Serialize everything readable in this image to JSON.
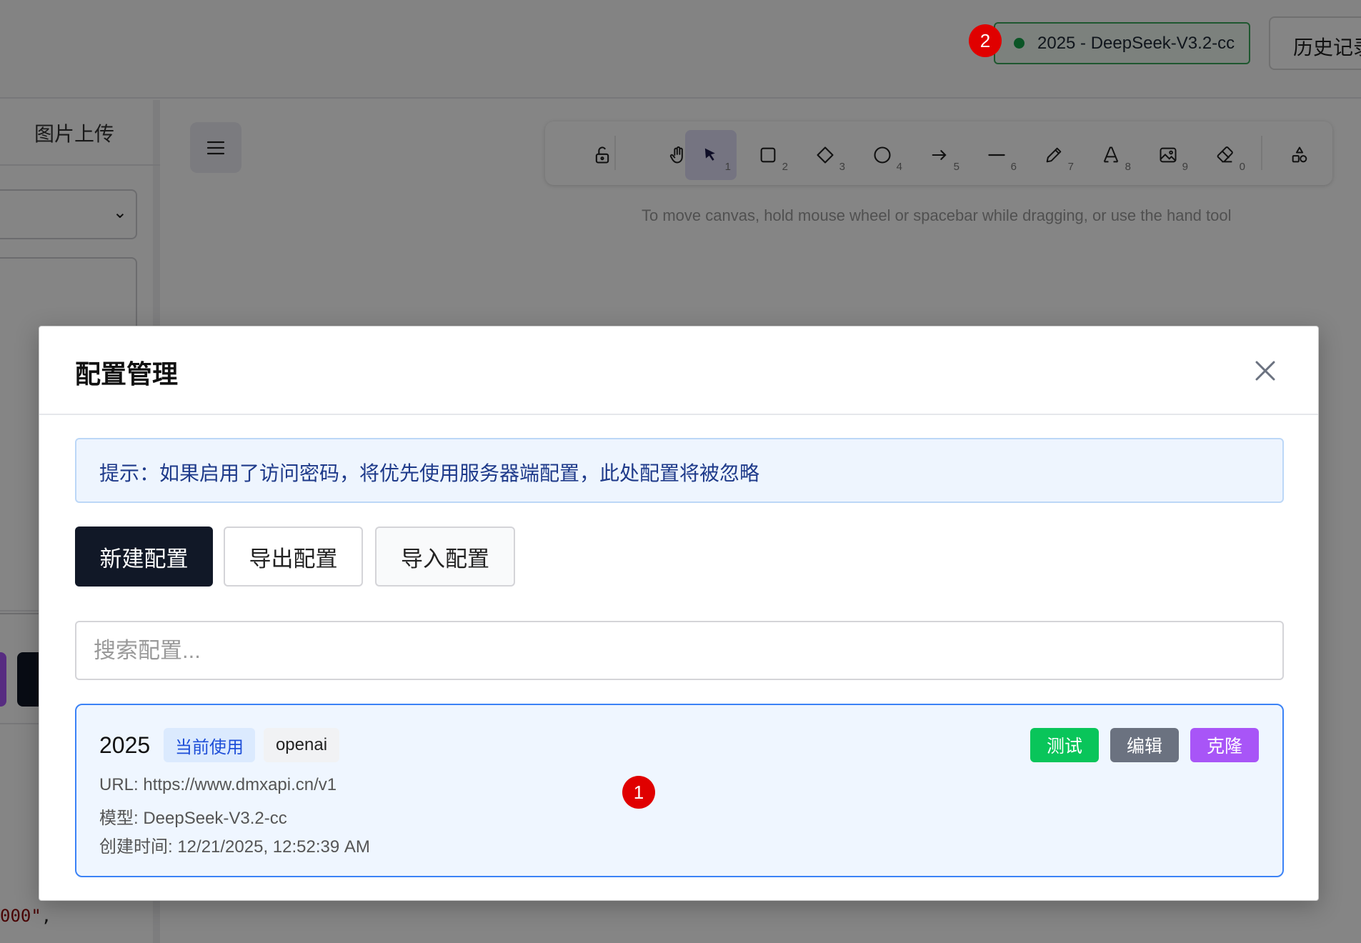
{
  "topbar": {
    "config_indicator": "2025 - DeepSeek-V3.2-cc",
    "history_button": "历史记录",
    "status_color": "#16a34a"
  },
  "markers": {
    "first": "1",
    "second": "2"
  },
  "sidebar": {
    "tab_label": "图片上传",
    "code_fragment": "000\"",
    "code_comma": ","
  },
  "toolbar": {
    "tools": [
      {
        "icon": "lock-open-icon",
        "shortcut": ""
      },
      {
        "icon": "hand-icon",
        "shortcut": ""
      },
      {
        "icon": "pointer-icon",
        "shortcut": "1",
        "active": true
      },
      {
        "icon": "rectangle-icon",
        "shortcut": "2"
      },
      {
        "icon": "diamond-icon",
        "shortcut": "3"
      },
      {
        "icon": "ellipse-icon",
        "shortcut": "4"
      },
      {
        "icon": "arrow-icon",
        "shortcut": "5"
      },
      {
        "icon": "line-icon",
        "shortcut": "6"
      },
      {
        "icon": "pencil-icon",
        "shortcut": "7"
      },
      {
        "icon": "text-icon",
        "shortcut": "8"
      },
      {
        "icon": "image-icon",
        "shortcut": "9"
      },
      {
        "icon": "eraser-icon",
        "shortcut": "0"
      },
      {
        "icon": "shapes-icon",
        "shortcut": ""
      }
    ],
    "canvas_hint": "To move canvas, hold mouse wheel or spacebar while dragging, or use the hand tool"
  },
  "modal": {
    "title": "配置管理",
    "notice": "提示：如果启用了访问密码，将优先使用服务器端配置，此处配置将被忽略",
    "buttons": {
      "new": "新建配置",
      "export": "导出配置",
      "import": "导入配置"
    },
    "search_placeholder": "搜索配置...",
    "configs": [
      {
        "name": "2025",
        "current_badge": "当前使用",
        "provider": "openai",
        "url_line": "URL: https://www.dmxapi.cn/v1",
        "model_line": "模型: DeepSeek-V3.2-cc",
        "created_line": "创建时间: 12/21/2025, 12:52:39 AM",
        "actions": {
          "test": "测试",
          "edit": "编辑",
          "clone": "克隆"
        }
      }
    ]
  },
  "colors": {
    "accent": "#3b82f6",
    "primary_dark": "#111827",
    "test": "#09c55a",
    "edit": "#6b7280",
    "clone": "#a855f7",
    "marker": "#e00000"
  }
}
